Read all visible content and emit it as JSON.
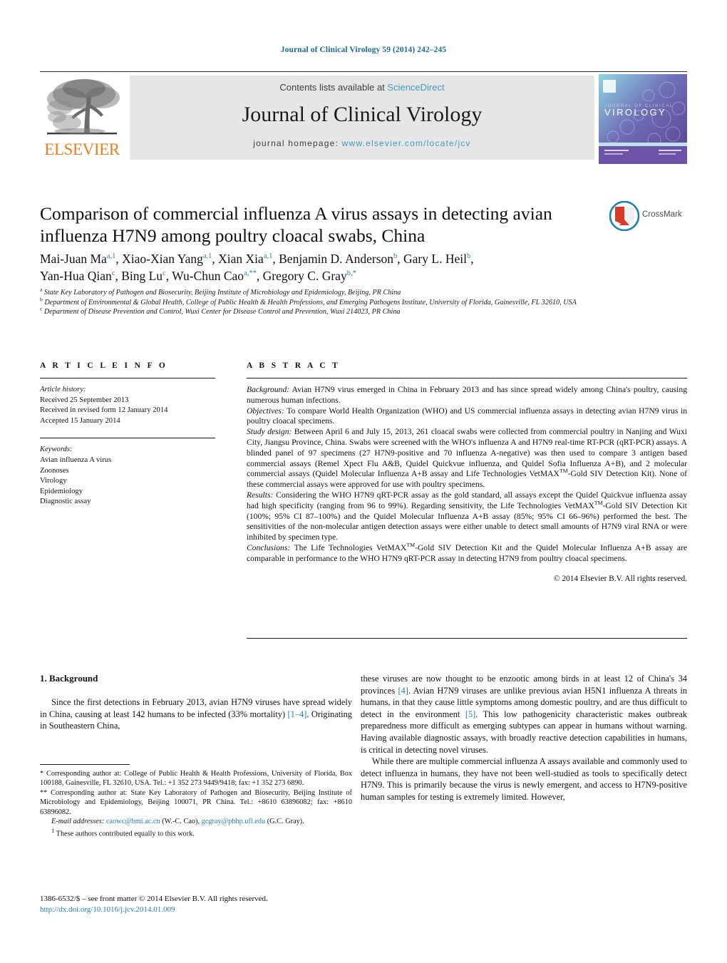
{
  "running_head": "Journal of Clinical Virology 59 (2014) 242–245",
  "masthead": {
    "publisher": "ELSEVIER",
    "contents_prefix": "Contents lists available at ",
    "contents_link": "ScienceDirect",
    "journal_title": "Journal of Clinical Virology",
    "homepage_prefix": "journal homepage: ",
    "homepage_url": "www.elsevier.com/locate/jcv",
    "cover_title": "VIROLOGY",
    "cover_subtitle": "JOURNAL OF CLINICAL",
    "link_color": "#3f9bc4",
    "publisher_color": "#ef7d1a"
  },
  "article": {
    "title": "Comparison of commercial influenza A virus assays in detecting avian influenza H7N9 among poultry cloacal swabs, China",
    "crossmark_label": "CrossMark",
    "authors_line1": "Mai-Juan Ma<sup>a,1</sup>, Xiao-Xian Yang<sup>a,1</sup>, Xian Xia<sup>a,1</sup>, Benjamin D. Anderson<sup>b</sup>, Gary L. Heil<sup>b</sup>,",
    "authors_line2": "Yan-Hua Qian<sup>c</sup>, Bing Lu<sup>c</sup>, Wu-Chun Cao<sup>a,**</sup>, Gregory C. Gray<sup>b,*</sup>",
    "affiliations": [
      "<sup>a</sup> State Key Laboratory of Pathogen and Biosecurity, Beijing Institute of Microbiology and Epidemiology, Beijing, PR China",
      "<sup>b</sup> Department of Environmental &amp; Global Health, College of Public Health &amp; Health Professions, and Emerging Pathogens Institute, University of Florida, Gainesville, FL 32610, USA",
      "<sup>c</sup> Department of Disease Prevention and Control, Wuxi Center for Disease Control and Prevention, Wuxi 214023, PR China"
    ]
  },
  "article_info": {
    "heading": "A R T I C L E    I N F O",
    "history_label": "Article history:",
    "history": [
      "Received 25 September 2013",
      "Received in revised form 12 January 2014",
      "Accepted 15 January 2014"
    ],
    "keywords_label": "Keywords:",
    "keywords": [
      "Avian influenza A virus",
      "Zoonoses",
      "Virology",
      "Epidemiology",
      "Diagnostic assay"
    ]
  },
  "abstract": {
    "heading": "A B S T R A C T",
    "sections": [
      {
        "label": "Background:",
        "text": " Avian H7N9 virus emerged in China in February 2013 and has since spread widely among China's poultry, causing numerous human infections."
      },
      {
        "label": "Objectives:",
        "text": " To compare World Health Organization (WHO) and US commercial influenza assays in detecting avian H7N9 virus in poultry cloacal specimens."
      },
      {
        "label": "Study design:",
        "text": " Between April 6 and July 15, 2013, 261 cloacal swabs were collected from commercial poultry in Nanjing and Wuxi City, Jiangsu Province, China. Swabs were screened with the WHO's influenza A and H7N9 real-time RT-PCR (qRT-PCR) assays. A blinded panel of 97 specimens (27 H7N9-positive and 70 influenza A-negative) was then used to compare 3 antigen based commercial assays (Remel Xpect Flu A&amp;B, Quidel Quickvue influenza, and Quidel Sofia Influenza A+B), and 2 molecular commercial assays (Quidel Molecular Influenza A+B assay and Life Technologies VetMAX<sup>TM</sup>-Gold SIV Detection Kit). None of these commercial assays were approved for use with poultry specimens."
      },
      {
        "label": "Results:",
        "text": " Considering the WHO H7N9 qRT-PCR assay as the gold standard, all assays except the Quidel Quickvue influenza assay had high specificity (ranging from 96 to 99%). Regarding sensitivity, the Life Technologies VetMAX<sup>TM</sup>-Gold SIV Detection Kit (100%; 95% CI 87–100%) and the Quidel Molecular Influenza A+B assay (85%; 95% CI 66–96%) performed the best. The sensitivities of the non-molecular antigen detection assays were either unable to detect small amounts of H7N9 viral RNA or were inhibited by specimen type."
      },
      {
        "label": "Conclusions:",
        "text": " The Life Technologies VetMAX<sup>TM</sup>-Gold SIV Detection Kit and the Quidel Molecular Influenza A+B assay are comparable in performance to the WHO H7N9 qRT-PCR assay in detecting H7N9 from poultry cloacal specimens."
      }
    ],
    "copyright": "© 2014 Elsevier B.V. All rights reserved."
  },
  "body": {
    "section_heading": "1.  Background",
    "left_paragraph": "Since the first detections in February 2013, avian H7N9 viruses have spread widely in China, causing at least 142 humans to be infected (33% mortality) <span class=\"ref\">[1–4]</span>. Originating in Southeastern China,",
    "right_paragraph_1": "these viruses are now thought to be enzootic among birds in at least 12 of China's 34 provinces <span class=\"ref\">[4]</span>. Avian H7N9 viruses are unlike previous avian H5N1 influenza A threats in humans, in that they cause little symptoms among domestic poultry, and are thus difficult to detect in the environment <span class=\"ref\">[5]</span>. This low pathogenicity characteristic makes outbreak preparedness more difficult as emerging subtypes can appear in humans without warning. Having available diagnostic assays, with broadly reactive detection capabilities in humans, is critical in detecting novel viruses.",
    "right_paragraph_2": "While there are multiple commercial influenza A assays available and commonly used to detect influenza in humans, they have not been well-studied as tools to specifically detect H7N9. This is primarily because the virus is newly emergent, and access to H7N9-positive human samples for testing is extremely limited. However,"
  },
  "footnotes": {
    "corresponding_1": "<span class=\"mark\">*</span> Corresponding author at: College of Public Health &amp; Health Professions, University of Florida, Box 100188, Gainesville, FL 32610, USA. Tel.: +1 352 273 9449/9418; fax: +1 352 273 6890.",
    "corresponding_2": "<span class=\"mark\">**</span> Corresponding author at: State Key Laboratory of Pathogen and Biosecurity, Beijing Institute of Microbiology and Epidemiology, Beijing 100071, PR China. Tel.: +8610 63896082; fax: +8610 63896082.",
    "emails": "<em>E-mail addresses:</em> <span class=\"email-link\">caowc@bmi.ac.cn</span> (W.-C. Cao), <span class=\"email-link\">gcgray@phhp.ufl.edu</span> (G.C. Gray).",
    "equal_contribution": "<sup>1</sup> These authors contributed equally to this work."
  },
  "frontmatter": {
    "issn_line": "1386-6532/$ – see front matter © 2014 Elsevier B.V. All rights reserved.",
    "doi": "http://dx.doi.org/10.1016/j.jcv.2014.01.009"
  }
}
